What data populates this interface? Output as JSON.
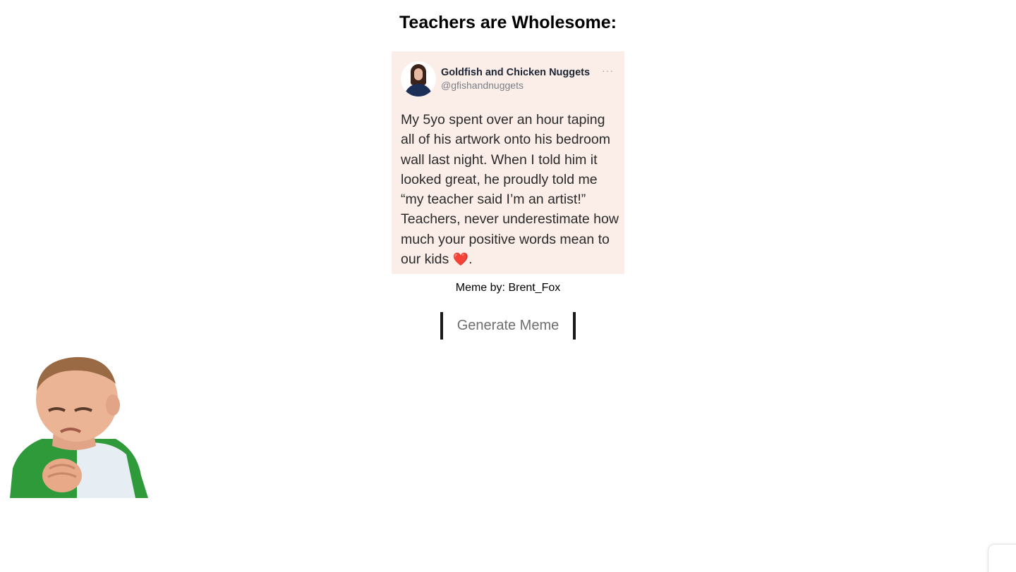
{
  "page": {
    "title": "Teachers are Wholesome:"
  },
  "meme": {
    "tweet": {
      "name": "Goldfish and Chicken Nuggets",
      "handle": "@gfishandnuggets",
      "more": "···",
      "lines": [
        "My 5yo spent over an hour taping",
        "all of his artwork onto his bedroom",
        "wall last night.  When I told him it",
        "looked great, he proudly told me",
        "“my teacher said I’m an artist!”",
        "Teachers, never underestimate how",
        "much your positive words mean to",
        "our kids"
      ],
      "last_punct": ".",
      "emoji": "❤️"
    }
  },
  "credit": "Meme by: Brent_Fox",
  "button": {
    "label": "Generate Meme"
  },
  "colors": {
    "meme_bg": "#fbeee8",
    "button_text": "#6f6f6f",
    "button_border": "#1a1a1a"
  }
}
